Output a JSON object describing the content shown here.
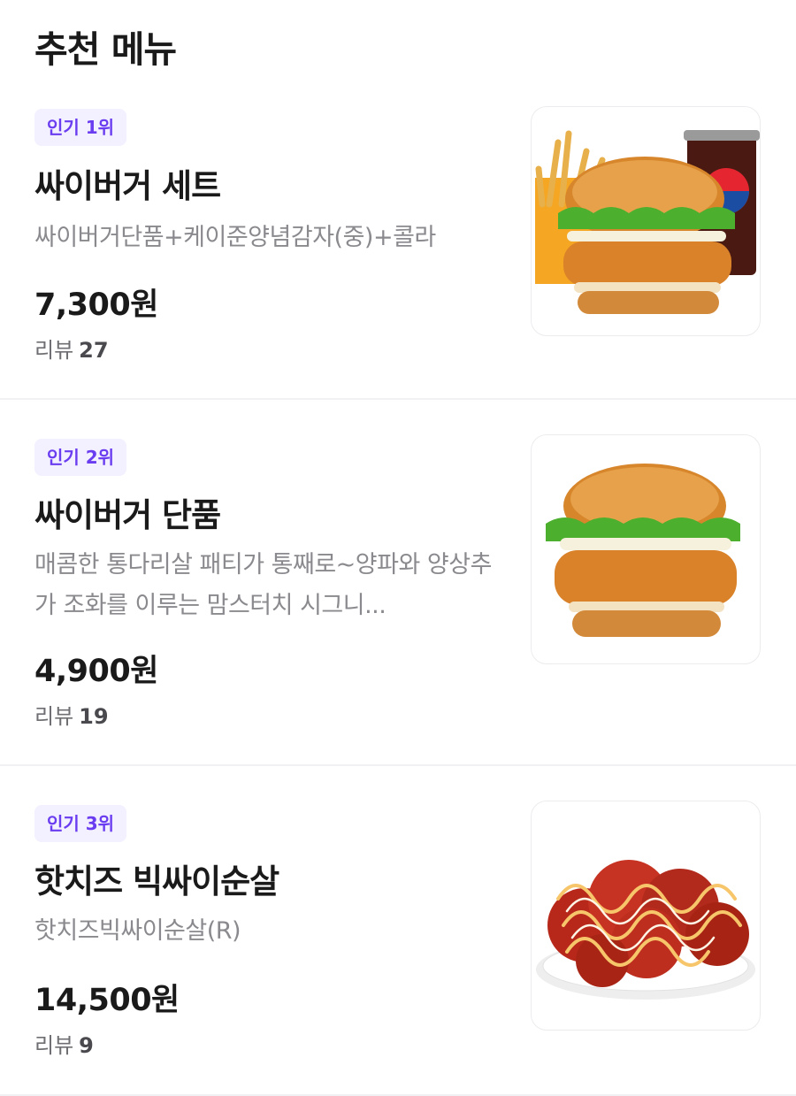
{
  "section": {
    "title": "추천 메뉴"
  },
  "items": [
    {
      "badge": "인기 1위",
      "name": "싸이버거 세트",
      "desc": "싸이버거단품+케이준양념감자(중)+콜라",
      "price": "7,300원",
      "review_label": "리뷰",
      "review_count": "27",
      "image": "burger-set-image"
    },
    {
      "badge": "인기 2위",
      "name": "싸이버거 단품",
      "desc": "매콤한 통다리살 패티가 통째로~양파와 양상추가 조화를 이루는 맘스터치 시그니...",
      "price": "4,900원",
      "review_label": "리뷰",
      "review_count": "19",
      "image": "burger-image"
    },
    {
      "badge": "인기 3위",
      "name": "핫치즈 빅싸이순살",
      "desc": "핫치즈빅싸이순살(R)",
      "price": "14,500원",
      "review_label": "리뷰",
      "review_count": "9",
      "image": "chicken-image"
    }
  ]
}
